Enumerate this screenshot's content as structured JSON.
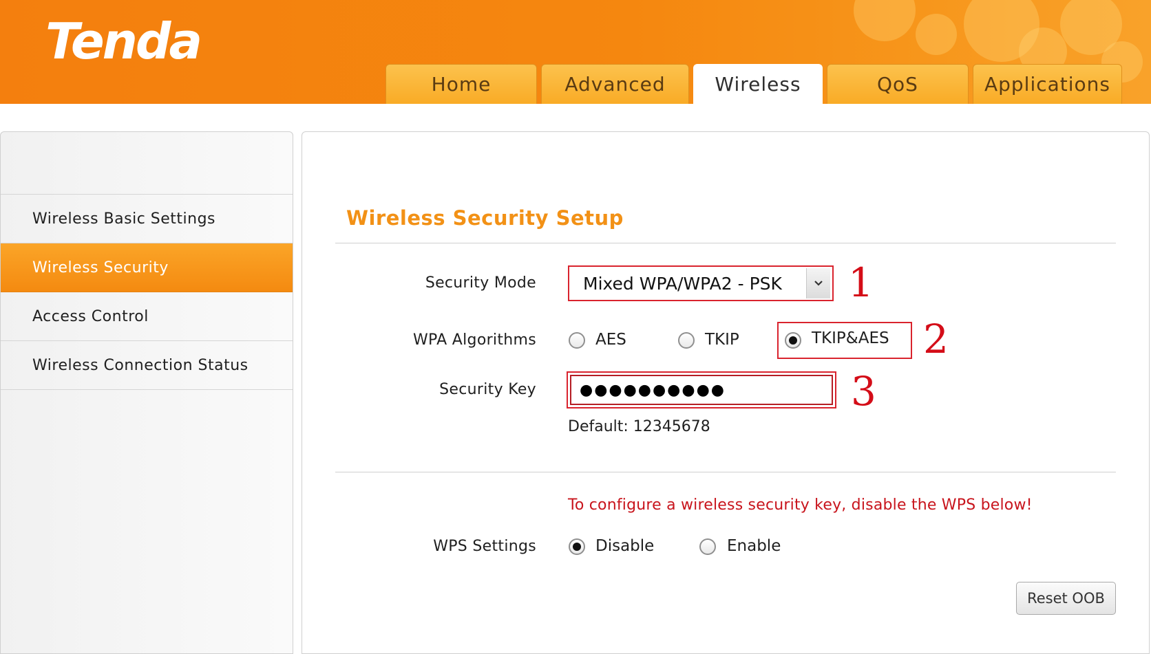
{
  "brand": {
    "logo_text": "Tenda"
  },
  "nav": {
    "tabs": [
      {
        "label": "Home"
      },
      {
        "label": "Advanced"
      },
      {
        "label": "Wireless"
      },
      {
        "label": "QoS"
      },
      {
        "label": "Applications"
      }
    ],
    "active_tab": "Wireless"
  },
  "sidebar": {
    "items": [
      {
        "label": "Wireless Basic Settings"
      },
      {
        "label": "Wireless Security"
      },
      {
        "label": "Access Control"
      },
      {
        "label": "Wireless Connection Status"
      }
    ],
    "active_item": "Wireless Security"
  },
  "main": {
    "title": "Wireless Security Setup",
    "security_mode": {
      "label": "Security Mode",
      "value": "Mixed WPA/WPA2 - PSK"
    },
    "wpa_algorithms": {
      "label": "WPA Algorithms",
      "options": [
        "AES",
        "TKIP",
        "TKIP&AES"
      ],
      "selected": "TKIP&AES"
    },
    "security_key": {
      "label": "Security Key",
      "value": "●●●●●●●●●●"
    },
    "default_key": "Default:  12345678",
    "wps_warning": "To configure a wireless security key, disable the WPS below!",
    "wps_settings": {
      "label": "WPS Settings",
      "options": [
        "Disable",
        "Enable"
      ],
      "selected": "Disable"
    },
    "reset_button": "Reset OOB"
  },
  "annotations": [
    "1",
    "2",
    "3"
  ],
  "colors": {
    "brand_orange": "#f5870f",
    "title_orange": "#f29116",
    "highlight_red": "#d9232d",
    "warning_red": "#c8141c"
  }
}
